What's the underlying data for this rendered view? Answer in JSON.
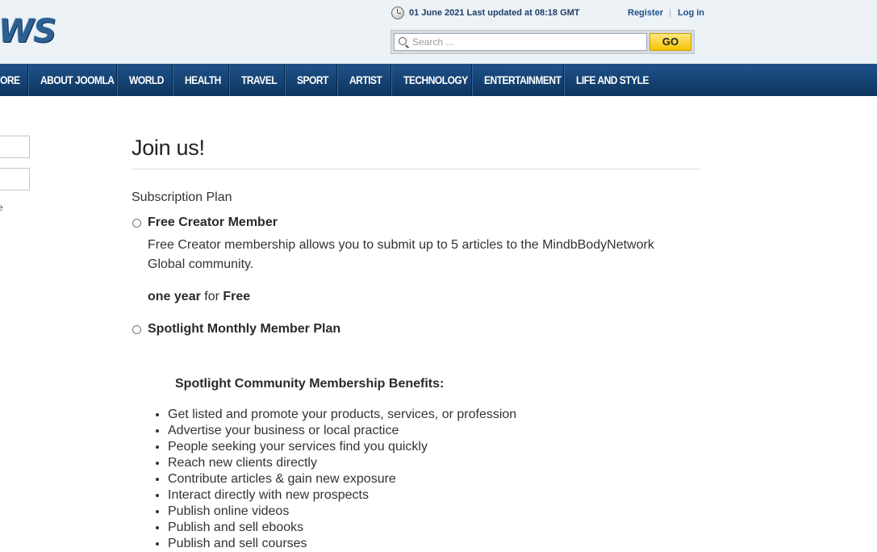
{
  "header": {
    "logo_fragment": "WS",
    "date_text": "01 June 2021 Last updated at 08:18 GMT",
    "register_label": "Register",
    "separator": "|",
    "login_label": "Log in",
    "search": {
      "placeholder": "Search ...",
      "button_label": "GO"
    },
    "colors": {
      "background": "#edf2f6",
      "accent": "#f5c400",
      "link": "#1f4f86"
    }
  },
  "nav": {
    "items": [
      "ORE",
      "ABOUT JOOMLA",
      "WORLD",
      "HEALTH",
      "TRAVEL",
      "SPORT",
      "ARTIST",
      "TECHNOLOGY",
      "ENTERTAINMENT",
      "LIFE AND STYLE"
    ],
    "background": "#0d355f"
  },
  "sidebar": {
    "fragment_text": "e"
  },
  "main": {
    "title": "Join us!",
    "subscription_label": "Subscription Plan",
    "plans": [
      {
        "name": "Free Creator Member",
        "description": "Free Creator membership allows you to submit up to 5 articles to the MindbBodyNetwork Global community.",
        "term": {
          "duration": "one year",
          "connector": " for ",
          "price": "Free"
        }
      },
      {
        "name": "Spotlight Monthly Member Plan"
      }
    ],
    "benefits_heading": "Spotlight Community Membership Benefits:",
    "benefits": [
      "Get listed and promote your products, services, or profession",
      "Advertise your business or local practice",
      "People seeking your services find you quickly",
      "Reach new clients directly",
      "Contribute articles & gain new exposure",
      "Interact directly with new prospects",
      "Publish online videos",
      "Publish and sell ebooks",
      "Publish and sell courses"
    ]
  }
}
